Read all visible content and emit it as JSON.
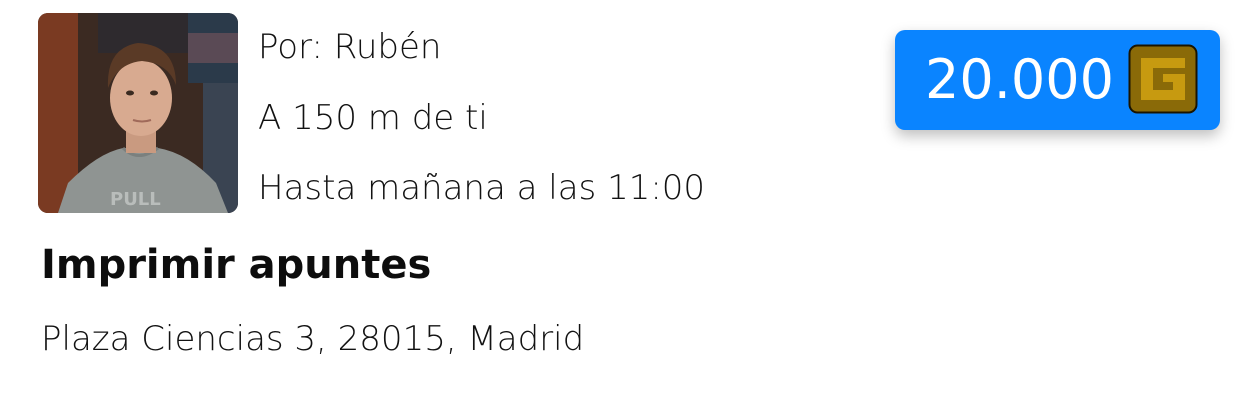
{
  "task": {
    "author": "Por: Rubén",
    "distance": "A 150 m de ti",
    "deadline": "Hasta mañana a las 11:00",
    "title": "Imprimir apuntes",
    "address": "Plaza Ciencias 3, 28015, Madrid"
  },
  "price": {
    "value": "20.000",
    "currency_icon": "coin-g-icon",
    "badge_color": "#0a84ff"
  },
  "avatar": {
    "icon": "user-avatar-photo"
  }
}
